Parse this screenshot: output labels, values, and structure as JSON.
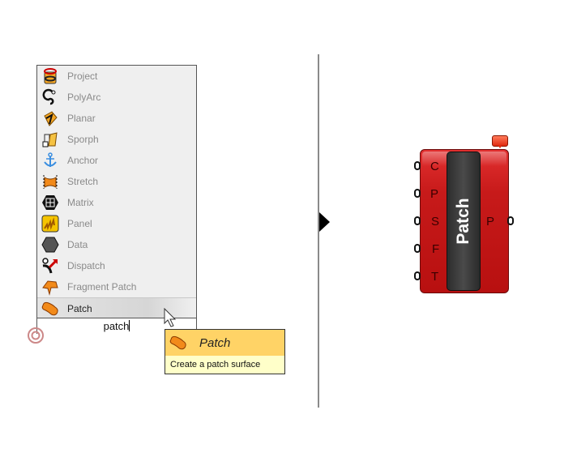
{
  "search_list": {
    "items": [
      {
        "label": "Project",
        "icon": "project-icon"
      },
      {
        "label": "PolyArc",
        "icon": "polyarc-icon"
      },
      {
        "label": "Planar",
        "icon": "planar-icon"
      },
      {
        "label": "Sporph",
        "icon": "sporph-icon"
      },
      {
        "label": "Anchor",
        "icon": "anchor-icon"
      },
      {
        "label": "Stretch",
        "icon": "stretch-icon"
      },
      {
        "label": "Matrix",
        "icon": "matrix-icon"
      },
      {
        "label": "Panel",
        "icon": "panel-icon"
      },
      {
        "label": "Data",
        "icon": "data-icon"
      },
      {
        "label": "Dispatch",
        "icon": "dispatch-icon"
      },
      {
        "label": "Fragment Patch",
        "icon": "fragment-patch-icon"
      },
      {
        "label": "Patch",
        "icon": "patch-icon",
        "selected": true
      }
    ],
    "search_value": "patch"
  },
  "tooltip": {
    "title": "Patch",
    "description": "Create a patch surface"
  },
  "component": {
    "name": "Patch",
    "inputs": [
      "C",
      "P",
      "S",
      "F",
      "T"
    ],
    "outputs": [
      "P"
    ],
    "color": "#c71a1a"
  }
}
